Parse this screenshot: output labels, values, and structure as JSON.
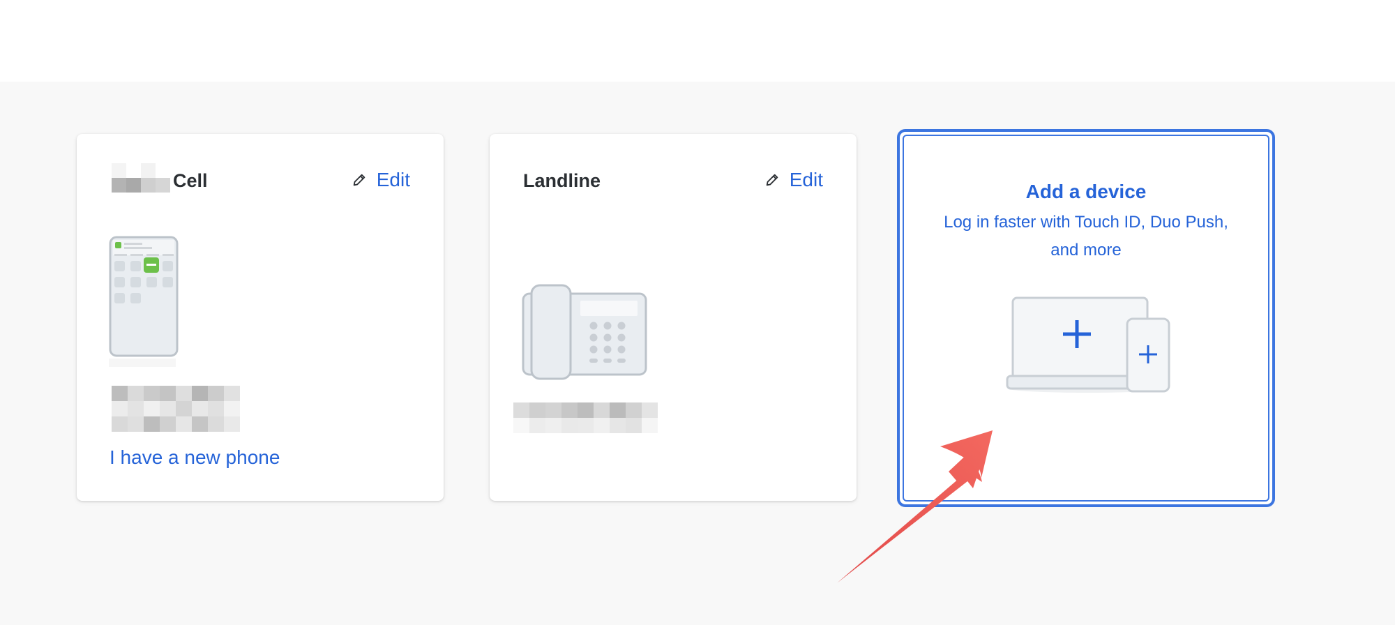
{
  "devices": [
    {
      "name_suffix": "Cell",
      "edit_label": "Edit",
      "action_link": "I have a new phone",
      "icon": "smartphone-icon"
    },
    {
      "name": "Landline",
      "edit_label": "Edit",
      "icon": "desk-phone-icon"
    }
  ],
  "add_device": {
    "title": "Add a device",
    "subtitle": "Log in faster with Touch ID, Duo Push, and more",
    "icon": "laptop-and-phone-plus-icon"
  },
  "colors": {
    "accent": "#2563d8",
    "card_border_selected": "#3c75e0",
    "annotation_arrow": "#ef5350",
    "background": "#f8f8f8"
  }
}
